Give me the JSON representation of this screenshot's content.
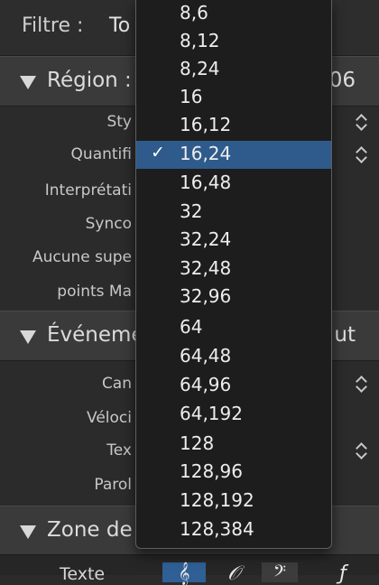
{
  "filter": {
    "label": "Filtre :",
    "value": "To"
  },
  "region": {
    "title": "Région :",
    "value": "06",
    "params": [
      {
        "label": "Sty",
        "stepper": true
      },
      {
        "label": "Quantifi",
        "stepper": true
      },
      {
        "label": "Interprétati",
        "stepper": false
      },
      {
        "label": "Synco",
        "stepper": false
      },
      {
        "label": "Aucune supe",
        "stepper": false
      },
      {
        "label": "points Ma",
        "stepper": false
      }
    ]
  },
  "events": {
    "title": "Événeme",
    "value": "ut",
    "params": [
      {
        "label": "Can",
        "stepper": true
      },
      {
        "label": "Véloci",
        "stepper": false
      },
      {
        "label": "Tex",
        "stepper": true
      },
      {
        "label": "Parol",
        "stepper": false
      }
    ]
  },
  "zone": {
    "title": "Zone de"
  },
  "bottom": {
    "label": "Texte",
    "segments": [
      "𝄞",
      "𝒪",
      "𝄢",
      "ƒ"
    ]
  },
  "dropdown": {
    "selected_index": 5,
    "check_mark": "✓",
    "items": [
      "8,6",
      "8,12",
      "8,24",
      "16",
      "16,12",
      "16,24",
      "16,48",
      "32",
      "32,24",
      "32,48",
      "32,96",
      "64",
      "64,48",
      "64,96",
      "64,192",
      "128",
      "128,96",
      "128,192",
      "128,384"
    ]
  }
}
